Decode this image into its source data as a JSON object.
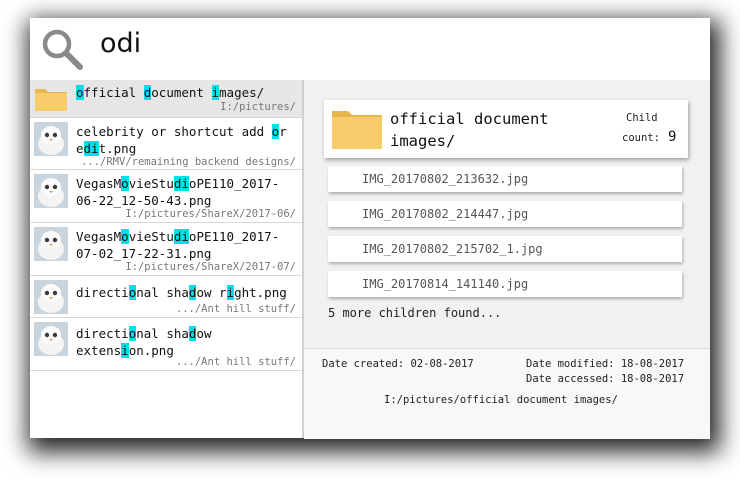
{
  "search": {
    "query": "odi"
  },
  "results": [
    {
      "type": "folder",
      "name_parts": [
        [
          "o",
          true
        ],
        [
          "fficial ",
          false
        ],
        [
          "d",
          true
        ],
        [
          "ocument ",
          false
        ],
        [
          "i",
          true
        ],
        [
          "mages/",
          false
        ]
      ],
      "path": "I:/pictures/"
    },
    {
      "type": "image",
      "name_parts": [
        [
          "celebrity or shortcut add ",
          false
        ],
        [
          "o",
          true
        ],
        [
          "r\ne",
          false
        ],
        [
          "di",
          true
        ],
        [
          "t.png",
          false
        ]
      ],
      "path": ".../RMV/remaining backend designs/"
    },
    {
      "type": "image",
      "name_parts": [
        [
          "Vegas",
          false
        ],
        [
          "M",
          false
        ],
        [
          "o",
          true
        ],
        [
          "vieStu",
          false
        ],
        [
          "di",
          true
        ],
        [
          "oPE110_2017-\n06-22_12-50-43.png",
          false
        ]
      ],
      "path": "I:/pictures/ShareX/2017-06/"
    },
    {
      "type": "image",
      "name_parts": [
        [
          "Vegas",
          false
        ],
        [
          "M",
          false
        ],
        [
          "o",
          true
        ],
        [
          "vieStu",
          false
        ],
        [
          "di",
          true
        ],
        [
          "oPE110_2017-\n07-02_17-22-31.png",
          false
        ]
      ],
      "path": "I:/pictures/ShareX/2017-07/"
    },
    {
      "type": "image",
      "name_parts": [
        [
          "directi",
          false
        ],
        [
          "o",
          true
        ],
        [
          "nal sha",
          false
        ],
        [
          "d",
          true
        ],
        [
          "ow r",
          false
        ],
        [
          "i",
          true
        ],
        [
          "ght.png",
          false
        ]
      ],
      "path": ".../Ant hill stuff/"
    },
    {
      "type": "image",
      "name_parts": [
        [
          "directi",
          false
        ],
        [
          "o",
          true
        ],
        [
          "nal sha",
          false
        ],
        [
          "d",
          true
        ],
        [
          "ow\nextens",
          false
        ],
        [
          "i",
          true
        ],
        [
          "on.png",
          false
        ]
      ],
      "path": ".../Ant hill stuff/"
    }
  ],
  "detail": {
    "title": "official document\nimages/",
    "child_label": "Child",
    "count_label": "count:",
    "count_value": "9",
    "children": [
      "IMG_20170802_213632.jpg",
      "IMG_20170802_214447.jpg",
      "IMG_20170802_215702_1.jpg",
      "IMG_20170814_141140.jpg"
    ],
    "more_text": "5 more children found...",
    "date_created": "Date created: 02-08-2017",
    "date_modified": "Date modified: 18-08-2017",
    "date_accessed": "Date accessed: 18-08-2017",
    "full_path": "I:/pictures/official document images/"
  },
  "colors": {
    "highlight": "#00e0ea",
    "folder": "#f3c766"
  }
}
